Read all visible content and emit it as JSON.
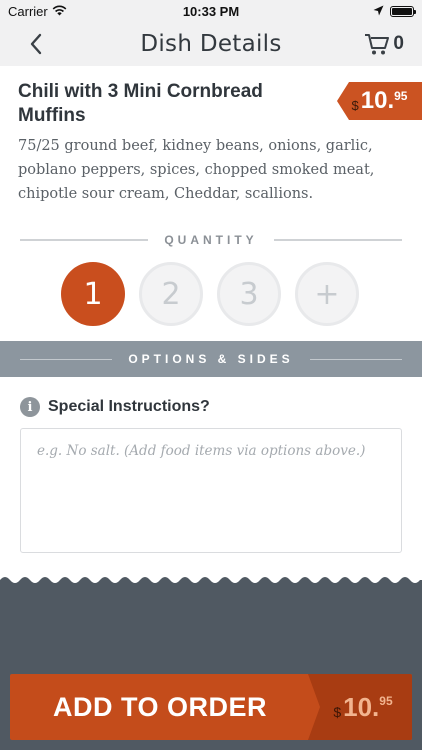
{
  "status_bar": {
    "carrier": "Carrier",
    "time": "10:33 PM"
  },
  "nav": {
    "title": "Dish Details",
    "cart_count": "0"
  },
  "dish": {
    "name": "Chili with 3 Mini Cornbread Muffins",
    "price_symbol": "$",
    "price_main": "10.",
    "price_cents": "95",
    "description": "75/25 ground beef, kidney beans, onions, garlic, poblano peppers, spices, chopped smoked meat, chipotle sour cream, Cheddar, scallions."
  },
  "quantity": {
    "label": "QUANTITY",
    "options": [
      "1",
      "2",
      "3",
      "+"
    ],
    "selected": "1"
  },
  "options_bar": {
    "label": "OPTIONS & SIDES"
  },
  "special": {
    "title": "Special Instructions?",
    "placeholder": "e.g. No salt. (Add food items via options above.)",
    "value": ""
  },
  "add_button": {
    "label": "ADD TO ORDER",
    "price_symbol": "$",
    "price_main": "10.",
    "price_cents": "95"
  },
  "colors": {
    "accent": "#c94e1e",
    "options_bar": "#8c969f",
    "bottom_area": "#505962"
  }
}
